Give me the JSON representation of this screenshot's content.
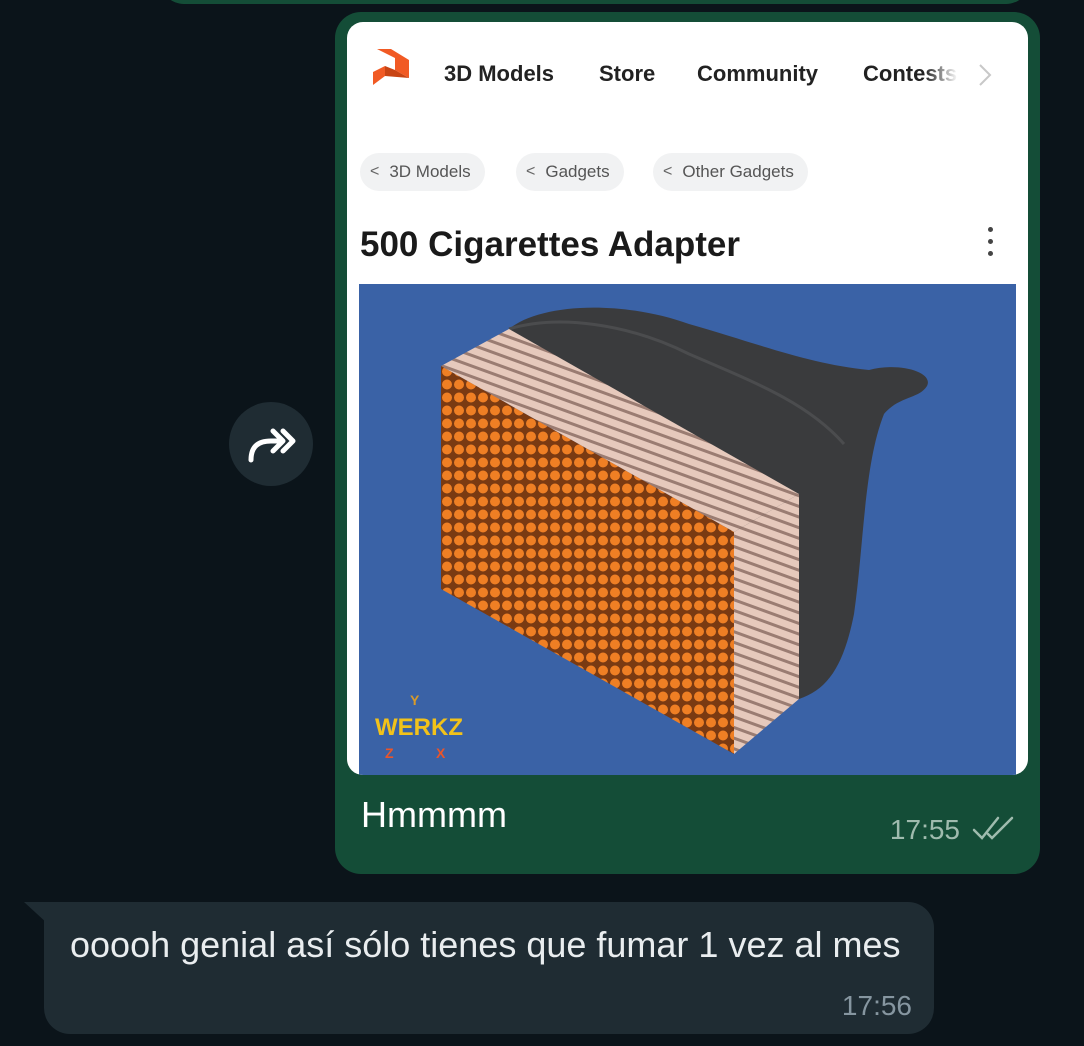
{
  "colors": {
    "chat_bg": "#0b141a",
    "outgoing_bubble": "#144d37",
    "incoming_bubble": "#1f2c33",
    "brand_orange": "#f15a24",
    "render_bg": "#3a62a6"
  },
  "forward_button": {
    "icon": "forward-icon"
  },
  "outgoing_message": {
    "shared_page": {
      "logo_icon": "printables-logo-icon",
      "nav": [
        {
          "label": "3D Models"
        },
        {
          "label": "Store"
        },
        {
          "label": "Community"
        },
        {
          "label": "Contests"
        }
      ],
      "nav_more_icon": "chevron-right-icon",
      "breadcrumbs": [
        {
          "label": "3D Models"
        },
        {
          "label": "Gadgets"
        },
        {
          "label": "Other Gadgets"
        }
      ],
      "title": "500 Cigarettes Adapter",
      "menu_icon": "kebab-menu-icon",
      "image": {
        "watermark": "WERKZ",
        "axis_labels": [
          "Y",
          "Z",
          "X"
        ]
      }
    },
    "text": "Hmmmm",
    "time": "17:55",
    "status_icon": "double-check-icon"
  },
  "incoming_message": {
    "text": "ooooh genial así sólo tienes que fumar 1 vez al mes",
    "time": "17:56"
  }
}
